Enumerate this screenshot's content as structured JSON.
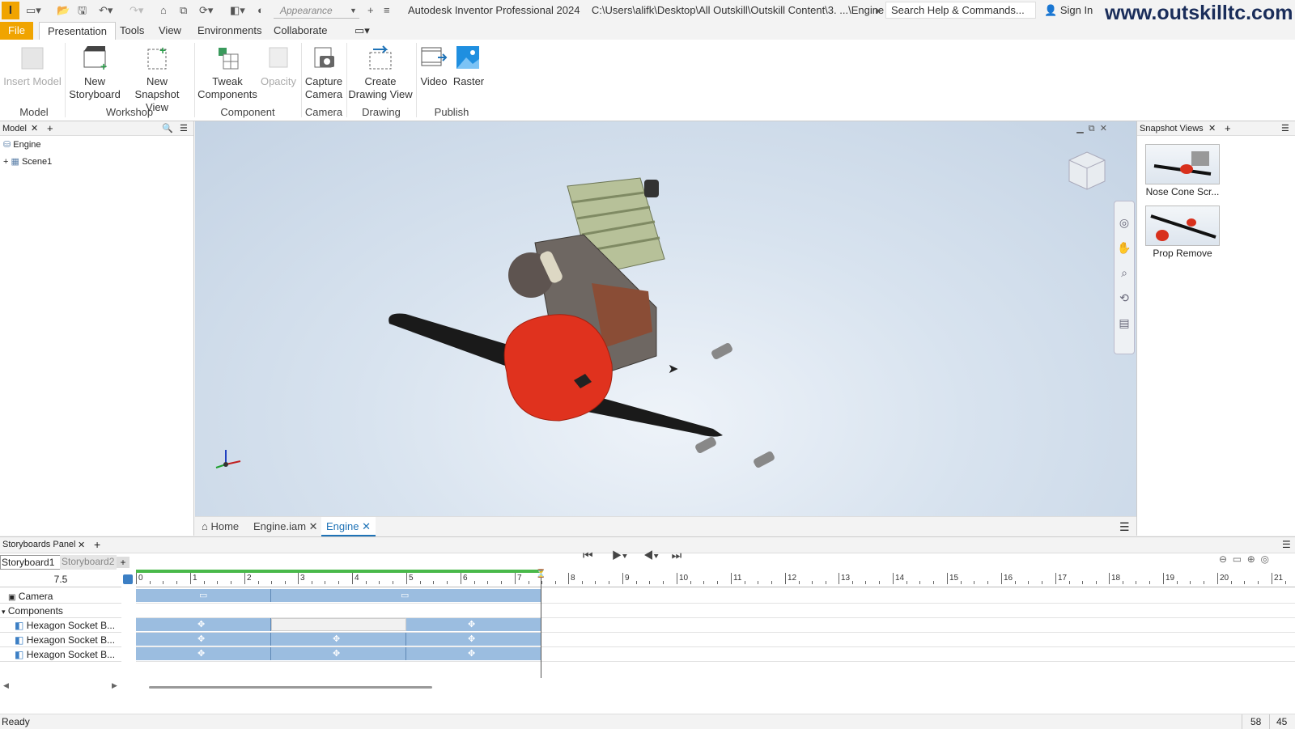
{
  "app": {
    "title": "Autodesk Inventor Professional 2024",
    "path": "C:\\Users\\alifk\\Desktop\\All Outskill\\Outskill Content\\3. ...\\Engine",
    "appearance_placeholder": "Appearance",
    "search_placeholder": "Search Help & Commands...",
    "sign_in": "Sign In",
    "watermark": "www.outskilltc.com",
    "app_icon": "I"
  },
  "menu": [
    "File",
    "Presentation",
    "Tools",
    "View",
    "Environments",
    "Collaborate"
  ],
  "ribbon": {
    "buttons": [
      {
        "label1": "Insert Model",
        "label2": "",
        "disabled": true
      },
      {
        "label1": "New",
        "label2": "Storyboard"
      },
      {
        "label1": "New",
        "label2": "Snapshot View"
      },
      {
        "label1": "Tweak",
        "label2": "Components"
      },
      {
        "label1": "Opacity",
        "label2": "",
        "disabled": true
      },
      {
        "label1": "Capture",
        "label2": "Camera"
      },
      {
        "label1": "Create",
        "label2": "Drawing View"
      },
      {
        "label1": "Video",
        "label2": ""
      },
      {
        "label1": "Raster",
        "label2": ""
      }
    ],
    "groups": [
      "Model",
      "Workshop",
      "Component",
      "Camera",
      "Drawing",
      "Publish"
    ]
  },
  "model_panel": {
    "tab": "Model",
    "root": "Engine",
    "child": "Scene1"
  },
  "doc_tabs": [
    "Home",
    "Engine.iam",
    "Engine"
  ],
  "snapshot_panel": {
    "tab": "Snapshot Views",
    "items": [
      "Nose Cone Scr...",
      "Prop Remove"
    ]
  },
  "storyboard": {
    "panel_tab": "Storyboards Panel",
    "tabs": [
      "Storyboard1",
      "Storyboard2"
    ],
    "current_time": "7.5",
    "ticks": [
      "0",
      "1",
      "2",
      "3",
      "4",
      "5",
      "6",
      "7",
      "8",
      "9",
      "10",
      "11",
      "12",
      "13",
      "14",
      "15",
      "16",
      "17",
      "18",
      "19",
      "20",
      "21"
    ],
    "rows": [
      "Camera",
      "Components",
      "Hexagon Socket B...",
      "Hexagon Socket B...",
      "Hexagon Socket B..."
    ]
  },
  "status": {
    "text": "Ready",
    "num1": "58",
    "num2": "45"
  },
  "colors": {
    "accent": "#f0a400",
    "active_blue": "#1f73b7",
    "track": "#9bbde0"
  }
}
